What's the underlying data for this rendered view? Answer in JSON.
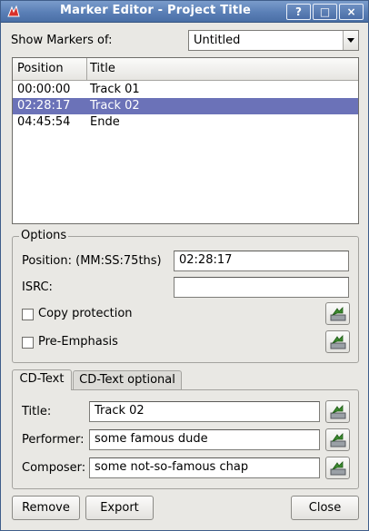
{
  "window": {
    "title": "Marker Editor - Project Title",
    "buttons": {
      "help": "?",
      "maximize": "□",
      "close": "×"
    }
  },
  "show_markers": {
    "label": "Show Markers of:",
    "selected": "Untitled"
  },
  "marker_list": {
    "columns": [
      "Position",
      "Title"
    ],
    "rows": [
      {
        "position": "00:00:00",
        "title": "Track 01",
        "selected": false
      },
      {
        "position": "02:28:17",
        "title": "Track 02",
        "selected": true
      },
      {
        "position": "04:45:54",
        "title": "Ende",
        "selected": false
      }
    ]
  },
  "options": {
    "group_title": "Options",
    "position_label": "Position: (MM:SS:75ths)",
    "position_value": "02:28:17",
    "isrc_label": "ISRC:",
    "isrc_value": "",
    "copy_protection_label": "Copy protection",
    "copy_protection_checked": false,
    "pre_emphasis_label": "Pre-Emphasis",
    "pre_emphasis_checked": false
  },
  "tabs": {
    "items": [
      "CD-Text",
      "CD-Text optional"
    ],
    "active": "CD-Text"
  },
  "cdtext": {
    "title_label": "Title:",
    "title_value": "Track 02",
    "performer_label": "Performer:",
    "performer_value": "some famous dude",
    "composer_label": "Composer:",
    "composer_value": "some not-so-famous chap"
  },
  "footer": {
    "remove_label": "Remove",
    "export_label": "Export",
    "close_label": "Close"
  },
  "colors": {
    "titlebar": "#5a7fb6",
    "selection": "#6b72b8",
    "window_bg": "#e9e8e4"
  },
  "icons": {
    "app": "k3b-flame-icon",
    "apply": "apply-to-all-icon"
  }
}
